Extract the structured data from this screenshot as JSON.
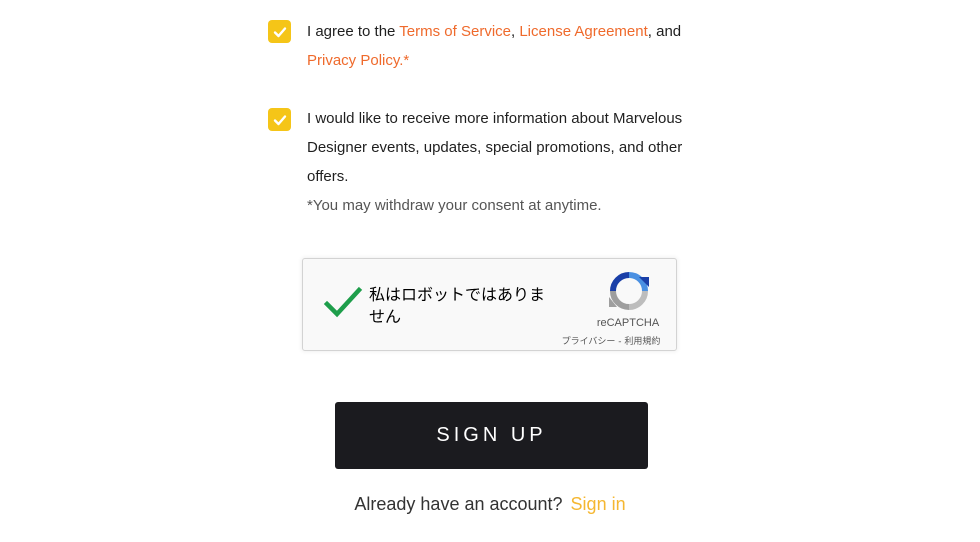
{
  "agree": {
    "checked": true,
    "line1_prefix": "I agree to the ",
    "terms_link": "Terms of Service",
    "sep1": ", ",
    "license_link": "License Agreement",
    "sep2": ", and",
    "privacy_link": "Privacy Policy",
    "period": ".",
    "required_mark": "*"
  },
  "marketing": {
    "checked": true,
    "line1": "I would like to receive more information about Marvelous",
    "line2": "Designer events, updates, special promotions, and other",
    "line3": "offers.",
    "note": "*You may withdraw your consent at anytime."
  },
  "recaptcha": {
    "label": "私はロボットではありません",
    "brand": "reCAPTCHA",
    "privacy": "プライバシー",
    "sep": " - ",
    "terms": "利用規約"
  },
  "signup_button": "SIGN UP",
  "signin": {
    "prompt": "Already have an account?",
    "link": "Sign in"
  },
  "colors": {
    "checkbox": "#f5c518",
    "link": "#ef6a2c",
    "button_bg": "#1b1b1f",
    "signin_link": "#f5b731",
    "recaptcha_check": "#1e9e4b"
  }
}
